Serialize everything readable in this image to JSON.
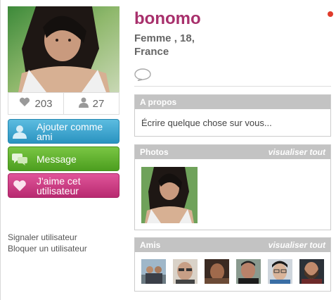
{
  "profile": {
    "username": "bonomo",
    "gender_age": "Femme , 18,",
    "country": "France",
    "online_color": "#e03b2c"
  },
  "stats": {
    "likes": "203",
    "friends": "27"
  },
  "actions": {
    "add_friend": "Ajouter comme ami",
    "message": "Message",
    "like": "J'aime cet utilisateur"
  },
  "side_links": {
    "report": "Signaler utilisateur",
    "block": "Bloquer un utilisateur"
  },
  "about": {
    "title": "A propos",
    "placeholder": "Écrire quelque chose sur vous..."
  },
  "photos": {
    "title": "Photos",
    "view_all": "visualiser tout"
  },
  "friends_panel": {
    "title": "Amis",
    "view_all": "visualiser tout",
    "count_shown": 6
  },
  "colors": {
    "brand": "#a8306c",
    "add_button": "#2a93c0",
    "message_button": "#4c9e1f",
    "like_button": "#b82a70"
  },
  "icons": [
    "heart-icon",
    "user-icon",
    "chat-bubble-icon",
    "add-user-icon",
    "message-icon"
  ]
}
